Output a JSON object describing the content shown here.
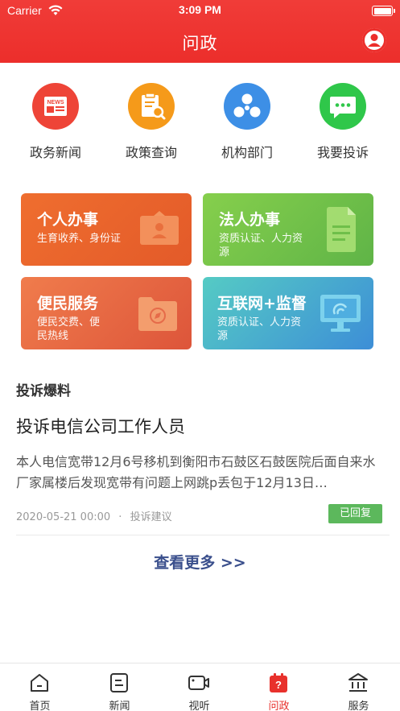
{
  "status_bar": {
    "carrier": "Carrier",
    "time": "3:09 PM"
  },
  "header": {
    "title": "问政"
  },
  "quick_actions": [
    {
      "label": "政务新闻",
      "icon": "news-icon",
      "badge": "NEWS",
      "color": "#ee4437"
    },
    {
      "label": "政策查询",
      "icon": "policy-search-icon",
      "color": "#f59a1a"
    },
    {
      "label": "机构部门",
      "icon": "organization-icon",
      "color": "#3d8fe6"
    },
    {
      "label": "我要投诉",
      "icon": "message-icon",
      "color": "#2fc74a"
    }
  ],
  "service_cards": [
    {
      "title": "个人办事",
      "subtitle": "生育收养、身份证",
      "icon": "person-card-icon",
      "colors": [
        "#ee6b2e",
        "#e45a2a"
      ]
    },
    {
      "title": "法人办事",
      "subtitle": "资质认证、人力资源",
      "icon": "document-icon",
      "colors": [
        "#7cc94a",
        "#5db447"
      ]
    },
    {
      "title": "便民服务",
      "subtitle": "便民交费、便民热线",
      "icon": "folder-compass-icon",
      "colors": [
        "#ef7a4a",
        "#e0563a"
      ]
    },
    {
      "title": "互联网+监督",
      "subtitle": "资质认证、人力资源",
      "icon": "monitor-icon",
      "colors": [
        "#4fc8c7",
        "#3f8fd6"
      ]
    }
  ],
  "complaint_section": {
    "title": "投诉爆料",
    "post": {
      "title": "投诉电信公司工作人员",
      "body": "本人电信宽带12月6号移机到衡阳市石鼓区石鼓医院后面自来水厂家属楼后发现宽带有问题上网跳p丢包于12月13日…",
      "date": "2020-05-21 00:00",
      "separator": "·",
      "category": "投诉建议",
      "status": "已回复"
    },
    "more_label": "查看更多 >>"
  },
  "tabbar": [
    {
      "label": "首页",
      "icon": "home-icon",
      "active": false
    },
    {
      "label": "新闻",
      "icon": "news-doc-icon",
      "active": false
    },
    {
      "label": "视听",
      "icon": "video-icon",
      "active": false
    },
    {
      "label": "问政",
      "icon": "question-icon",
      "active": true
    },
    {
      "label": "服务",
      "icon": "service-building-icon",
      "active": false
    }
  ],
  "colors": {
    "brand_red": "#ec2e2b",
    "link_blue": "#3a4f8c",
    "status_green": "#5cb85c"
  }
}
